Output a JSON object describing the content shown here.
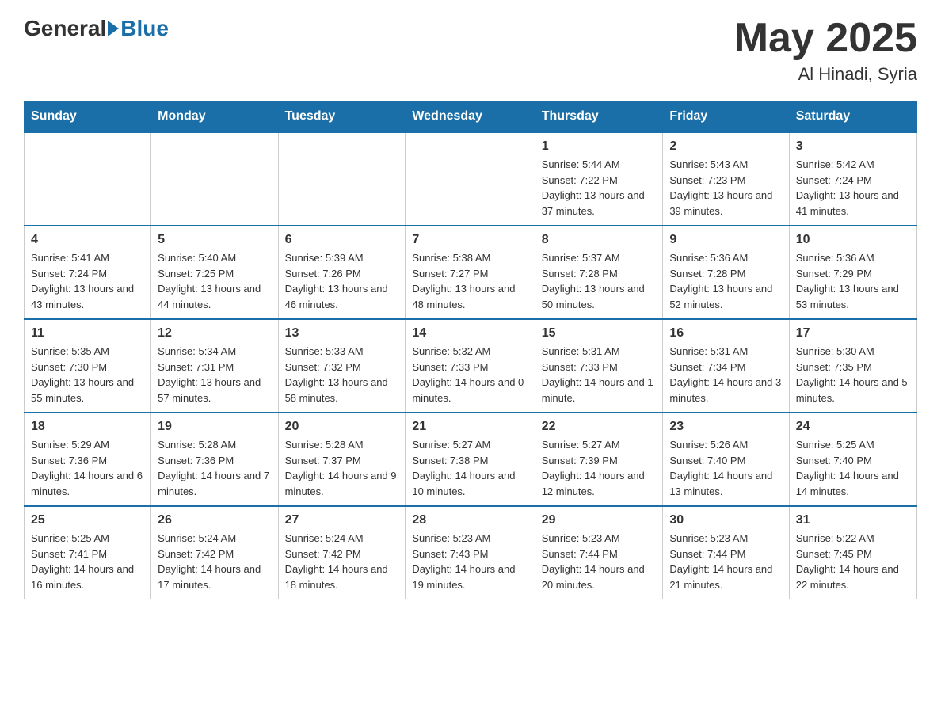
{
  "header": {
    "logo_general": "General",
    "logo_blue": "Blue",
    "month_year": "May 2025",
    "location": "Al Hinadi, Syria"
  },
  "days_of_week": [
    "Sunday",
    "Monday",
    "Tuesday",
    "Wednesday",
    "Thursday",
    "Friday",
    "Saturday"
  ],
  "weeks": [
    [
      {
        "day": "",
        "info": ""
      },
      {
        "day": "",
        "info": ""
      },
      {
        "day": "",
        "info": ""
      },
      {
        "day": "",
        "info": ""
      },
      {
        "day": "1",
        "info": "Sunrise: 5:44 AM\nSunset: 7:22 PM\nDaylight: 13 hours and 37 minutes."
      },
      {
        "day": "2",
        "info": "Sunrise: 5:43 AM\nSunset: 7:23 PM\nDaylight: 13 hours and 39 minutes."
      },
      {
        "day": "3",
        "info": "Sunrise: 5:42 AM\nSunset: 7:24 PM\nDaylight: 13 hours and 41 minutes."
      }
    ],
    [
      {
        "day": "4",
        "info": "Sunrise: 5:41 AM\nSunset: 7:24 PM\nDaylight: 13 hours and 43 minutes."
      },
      {
        "day": "5",
        "info": "Sunrise: 5:40 AM\nSunset: 7:25 PM\nDaylight: 13 hours and 44 minutes."
      },
      {
        "day": "6",
        "info": "Sunrise: 5:39 AM\nSunset: 7:26 PM\nDaylight: 13 hours and 46 minutes."
      },
      {
        "day": "7",
        "info": "Sunrise: 5:38 AM\nSunset: 7:27 PM\nDaylight: 13 hours and 48 minutes."
      },
      {
        "day": "8",
        "info": "Sunrise: 5:37 AM\nSunset: 7:28 PM\nDaylight: 13 hours and 50 minutes."
      },
      {
        "day": "9",
        "info": "Sunrise: 5:36 AM\nSunset: 7:28 PM\nDaylight: 13 hours and 52 minutes."
      },
      {
        "day": "10",
        "info": "Sunrise: 5:36 AM\nSunset: 7:29 PM\nDaylight: 13 hours and 53 minutes."
      }
    ],
    [
      {
        "day": "11",
        "info": "Sunrise: 5:35 AM\nSunset: 7:30 PM\nDaylight: 13 hours and 55 minutes."
      },
      {
        "day": "12",
        "info": "Sunrise: 5:34 AM\nSunset: 7:31 PM\nDaylight: 13 hours and 57 minutes."
      },
      {
        "day": "13",
        "info": "Sunrise: 5:33 AM\nSunset: 7:32 PM\nDaylight: 13 hours and 58 minutes."
      },
      {
        "day": "14",
        "info": "Sunrise: 5:32 AM\nSunset: 7:33 PM\nDaylight: 14 hours and 0 minutes."
      },
      {
        "day": "15",
        "info": "Sunrise: 5:31 AM\nSunset: 7:33 PM\nDaylight: 14 hours and 1 minute."
      },
      {
        "day": "16",
        "info": "Sunrise: 5:31 AM\nSunset: 7:34 PM\nDaylight: 14 hours and 3 minutes."
      },
      {
        "day": "17",
        "info": "Sunrise: 5:30 AM\nSunset: 7:35 PM\nDaylight: 14 hours and 5 minutes."
      }
    ],
    [
      {
        "day": "18",
        "info": "Sunrise: 5:29 AM\nSunset: 7:36 PM\nDaylight: 14 hours and 6 minutes."
      },
      {
        "day": "19",
        "info": "Sunrise: 5:28 AM\nSunset: 7:36 PM\nDaylight: 14 hours and 7 minutes."
      },
      {
        "day": "20",
        "info": "Sunrise: 5:28 AM\nSunset: 7:37 PM\nDaylight: 14 hours and 9 minutes."
      },
      {
        "day": "21",
        "info": "Sunrise: 5:27 AM\nSunset: 7:38 PM\nDaylight: 14 hours and 10 minutes."
      },
      {
        "day": "22",
        "info": "Sunrise: 5:27 AM\nSunset: 7:39 PM\nDaylight: 14 hours and 12 minutes."
      },
      {
        "day": "23",
        "info": "Sunrise: 5:26 AM\nSunset: 7:40 PM\nDaylight: 14 hours and 13 minutes."
      },
      {
        "day": "24",
        "info": "Sunrise: 5:25 AM\nSunset: 7:40 PM\nDaylight: 14 hours and 14 minutes."
      }
    ],
    [
      {
        "day": "25",
        "info": "Sunrise: 5:25 AM\nSunset: 7:41 PM\nDaylight: 14 hours and 16 minutes."
      },
      {
        "day": "26",
        "info": "Sunrise: 5:24 AM\nSunset: 7:42 PM\nDaylight: 14 hours and 17 minutes."
      },
      {
        "day": "27",
        "info": "Sunrise: 5:24 AM\nSunset: 7:42 PM\nDaylight: 14 hours and 18 minutes."
      },
      {
        "day": "28",
        "info": "Sunrise: 5:23 AM\nSunset: 7:43 PM\nDaylight: 14 hours and 19 minutes."
      },
      {
        "day": "29",
        "info": "Sunrise: 5:23 AM\nSunset: 7:44 PM\nDaylight: 14 hours and 20 minutes."
      },
      {
        "day": "30",
        "info": "Sunrise: 5:23 AM\nSunset: 7:44 PM\nDaylight: 14 hours and 21 minutes."
      },
      {
        "day": "31",
        "info": "Sunrise: 5:22 AM\nSunset: 7:45 PM\nDaylight: 14 hours and 22 minutes."
      }
    ]
  ]
}
